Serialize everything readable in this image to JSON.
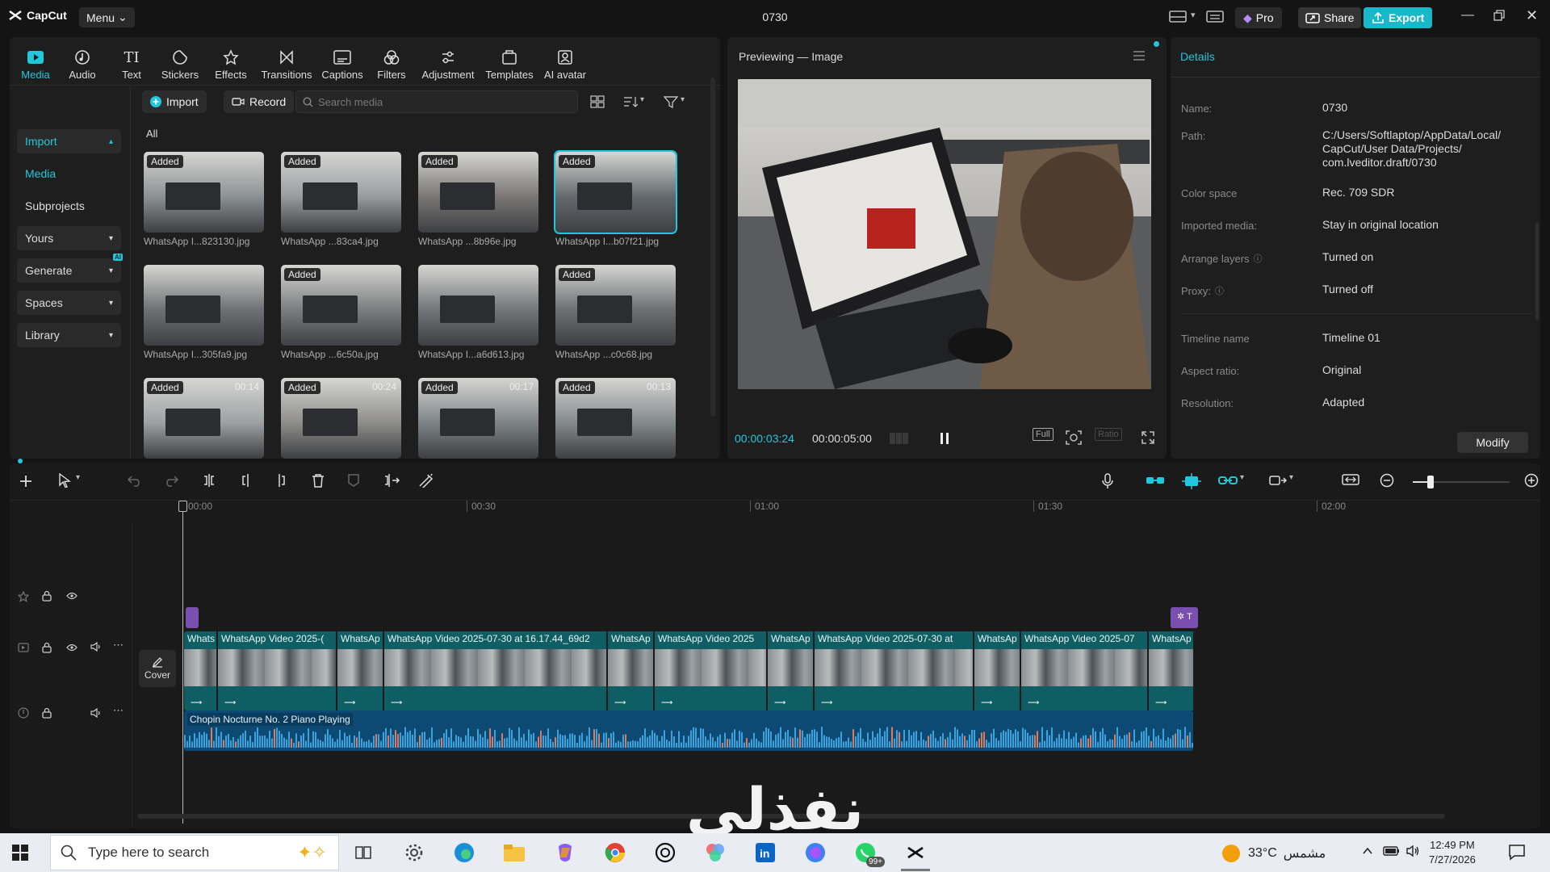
{
  "app": {
    "name": "CapCut",
    "menu_label": "Menu",
    "project_title": "0730"
  },
  "topbar": {
    "pro_label": "Pro",
    "share_label": "Share",
    "export_label": "Export"
  },
  "tabs": [
    {
      "label": "Media",
      "icon": "media-icon",
      "active": true
    },
    {
      "label": "Audio",
      "icon": "audio-icon"
    },
    {
      "label": "Text",
      "icon": "text-icon"
    },
    {
      "label": "Stickers",
      "icon": "stickers-icon"
    },
    {
      "label": "Effects",
      "icon": "effects-icon"
    },
    {
      "label": "Transitions",
      "icon": "transitions-icon"
    },
    {
      "label": "Captions",
      "icon": "captions-icon"
    },
    {
      "label": "Filters",
      "icon": "filters-icon"
    },
    {
      "label": "Adjustment",
      "icon": "adjustment-icon"
    },
    {
      "label": "Templates",
      "icon": "templates-icon"
    },
    {
      "label": "AI avatar",
      "icon": "ai-avatar-icon"
    }
  ],
  "leftnav": {
    "import": "Import",
    "media": "Media",
    "subprojects": "Subprojects",
    "yours": "Yours",
    "generate": "Generate",
    "spaces": "Spaces",
    "library": "Library",
    "ai_badge": "AI"
  },
  "media": {
    "import_btn": "Import",
    "record_btn": "Record",
    "search_placeholder": "Search media",
    "filter_all": "All",
    "items": [
      {
        "name": "WhatsApp I...823130.jpg",
        "badge": "Added",
        "duration": "",
        "tint": "#8d9294"
      },
      {
        "name": "WhatsApp ...83ca4.jpg",
        "badge": "Added",
        "duration": "",
        "tint": "#9a9da0"
      },
      {
        "name": "WhatsApp ...8b96e.jpg",
        "badge": "Added",
        "duration": "",
        "tint": "#7a7775"
      },
      {
        "name": "WhatsApp I...b07f21.jpg",
        "badge": "Added",
        "duration": "",
        "tint": "#646a6e",
        "selected": true
      },
      {
        "name": "WhatsApp I...305fa9.jpg",
        "badge": "",
        "duration": "",
        "tint": "#6f7275"
      },
      {
        "name": "WhatsApp ...6c50a.jpg",
        "badge": "Added",
        "duration": "",
        "tint": "#7c7e80"
      },
      {
        "name": "WhatsApp I...a6d613.jpg",
        "badge": "",
        "duration": "",
        "tint": "#73777a"
      },
      {
        "name": "WhatsApp ...c0c68.jpg",
        "badge": "Added",
        "duration": "",
        "tint": "#6d7174"
      },
      {
        "name": "",
        "badge": "Added",
        "duration": "00:14",
        "tint": "#9fa2a4"
      },
      {
        "name": "",
        "badge": "Added",
        "duration": "00:24",
        "tint": "#8f8e8c"
      },
      {
        "name": "",
        "badge": "Added",
        "duration": "00:17",
        "tint": "#7f8487"
      },
      {
        "name": "",
        "badge": "Added",
        "duration": "00:13",
        "tint": "#858a8d"
      }
    ]
  },
  "preview": {
    "title": "Previewing — Image",
    "time_current": "00:00:03:24",
    "time_total": "00:00:05:00",
    "full_label": "Full",
    "ratio_label": "Ratio"
  },
  "details": {
    "title": "Details",
    "rows": [
      {
        "label": "Name:",
        "value": "0730"
      },
      {
        "label": "Path:",
        "value": "C:/Users/Softlaptop/AppData/Local/ CapCut/User Data/Projects/ com.lveditor.draft/0730"
      },
      {
        "label": "Color space",
        "value": "Rec. 709 SDR"
      },
      {
        "label": "Imported media:",
        "value": "Stay in original location"
      },
      {
        "label": "Arrange layers",
        "value": "Turned on",
        "help": true
      },
      {
        "label": "Proxy:",
        "value": "Turned off",
        "help": true
      },
      {
        "label": "Timeline name",
        "value": "Timeline 01"
      },
      {
        "label": "Aspect ratio:",
        "value": "Original"
      },
      {
        "label": "Resolution:",
        "value": "Adapted"
      }
    ],
    "modify_label": "Modify"
  },
  "timeline": {
    "ruler": [
      "00:00",
      "00:30",
      "01:00",
      "01:30",
      "02:00"
    ],
    "cover_label": "Cover",
    "clips": [
      {
        "label": "Whats"
      },
      {
        "label": "WhatsApp Video 2025-("
      },
      {
        "label": "WhatsAp"
      },
      {
        "label": "WhatsApp Video 2025-07-30 at 16.17.44_69d2"
      },
      {
        "label": "WhatsAp"
      },
      {
        "label": "WhatsApp Video 2025"
      },
      {
        "label": "WhatsAp"
      },
      {
        "label": "WhatsApp Video 2025-07-30 at"
      },
      {
        "label": "WhatsAp"
      },
      {
        "label": "WhatsApp Video 2025-07"
      },
      {
        "label": "WhatsAp"
      }
    ],
    "audio_label": "Chopin Nocturne No. 2 Piano Playing"
  },
  "watermark": "نفذلي",
  "taskbar": {
    "search_placeholder": "Type here to search",
    "temperature": "33°C",
    "weather_text": "مشمس",
    "time": "12:49 PM",
    "date": "7/27/2026",
    "badge": "99+"
  },
  "colors": {
    "accent": "#22c7dc",
    "export": "#18b7c9",
    "video_track": "#0f5e63",
    "audio_track": "#0d4a73"
  }
}
